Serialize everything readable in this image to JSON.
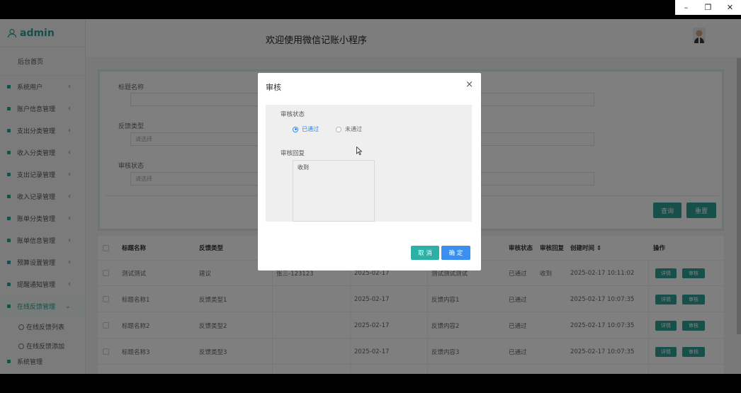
{
  "window": {
    "minimize": "–",
    "restore": "❐",
    "close": "✕"
  },
  "brand": {
    "name": "admin"
  },
  "header": {
    "title": "欢迎使用微信记账小程序"
  },
  "sidebar": {
    "home": "后台首页",
    "items": [
      {
        "label": "系统用户"
      },
      {
        "label": "账户信息管理"
      },
      {
        "label": "支出分类管理"
      },
      {
        "label": "收入分类管理"
      },
      {
        "label": "支出记录管理"
      },
      {
        "label": "收入记录管理"
      },
      {
        "label": "账单分类管理"
      },
      {
        "label": "账单信息管理"
      },
      {
        "label": "预算设置管理"
      },
      {
        "label": "提醒通知管理"
      },
      {
        "label": "在线反馈管理"
      }
    ],
    "sub_items": [
      {
        "label": "在线反馈列表"
      },
      {
        "label": "在线反馈添加"
      }
    ],
    "last_item": "系统管理"
  },
  "search": {
    "field1_label": "标题名称",
    "field2_label": "反馈类型",
    "field2_placeholder": "请选择",
    "field3_label": "审核状态",
    "field3_placeholder": "请选择",
    "query_button": "查询",
    "reset_button": "重置"
  },
  "table": {
    "headers": [
      "标题名称",
      "反馈类型",
      "审核状态",
      "审核回复",
      "创建时间 ⇕",
      "操作"
    ],
    "rows": [
      {
        "title": "测试测试",
        "type": "建议",
        "user": "张三-123123",
        "date": "2025-02-17",
        "content": "测试测试测试",
        "status": "已通过",
        "reply": "收到",
        "created": "2025-02-17 10:11:02"
      },
      {
        "title": "标题名称1",
        "type": "反馈类型1",
        "user": "",
        "date": "2025-02-17",
        "content": "反馈内容1",
        "status": "已通过",
        "reply": "",
        "created": "2025-02-17 10:07:35"
      },
      {
        "title": "标题名称2",
        "type": "反馈类型2",
        "user": "",
        "date": "2025-02-17",
        "content": "反馈内容2",
        "status": "已通过",
        "reply": "",
        "created": "2025-02-17 10:07:35"
      },
      {
        "title": "标题名称3",
        "type": "反馈类型3",
        "user": "",
        "date": "2025-02-17",
        "content": "反馈内容3",
        "status": "已通过",
        "reply": "",
        "created": "2025-02-17 10:07:35"
      }
    ],
    "detail_button": "详情",
    "audit_button": "审核"
  },
  "modal": {
    "title": "审核",
    "close": "×",
    "status_label": "审核状态",
    "option_pass": "已通过",
    "option_fail": "未通过",
    "selected": "已通过",
    "reply_label": "审核回复",
    "reply_value": "收到",
    "cancel_button": "取 消",
    "confirm_button": "确 定"
  },
  "colors": {
    "accent": "#2f9f95",
    "primary": "#2b83f6"
  }
}
